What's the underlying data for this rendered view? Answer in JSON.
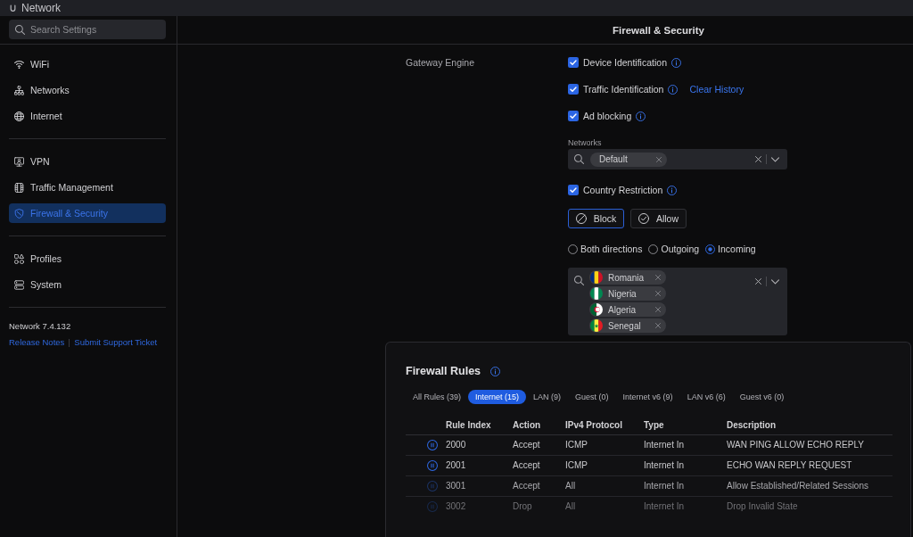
{
  "app": {
    "title": "Network"
  },
  "sidebar": {
    "search": {
      "placeholder": "Search Settings"
    },
    "sections": [
      {
        "items": [
          {
            "label": "WiFi",
            "selected": false
          },
          {
            "label": "Networks",
            "selected": false
          },
          {
            "label": "Internet",
            "selected": false
          }
        ]
      },
      {
        "items": [
          {
            "label": "VPN",
            "selected": false
          },
          {
            "label": "Traffic Management",
            "selected": false
          },
          {
            "label": "Firewall & Security",
            "selected": true
          }
        ]
      },
      {
        "items": [
          {
            "label": "Profiles",
            "selected": false
          },
          {
            "label": "System",
            "selected": false
          }
        ]
      }
    ],
    "version": "Network 7.4.132",
    "links": [
      "Release Notes",
      "Submit Support Ticket"
    ]
  },
  "page": {
    "title": "Firewall & Security"
  },
  "gateway_engine": {
    "label": "Gateway Engine",
    "options": [
      {
        "label": "Device Identification",
        "checked": true
      },
      {
        "label": "Traffic Identification",
        "checked": true,
        "link": "Clear History"
      },
      {
        "label": "Ad blocking",
        "checked": true
      }
    ],
    "networks": {
      "label": "Networks",
      "chips": [
        "Default"
      ]
    },
    "country_restriction": {
      "label": "Country Restriction",
      "checked": true
    },
    "modes": [
      {
        "label": "Block",
        "selected": true
      },
      {
        "label": "Allow",
        "selected": false
      }
    ],
    "directions": [
      {
        "label": "Both directions",
        "selected": false
      },
      {
        "label": "Outgoing",
        "selected": false
      },
      {
        "label": "Incoming",
        "selected": true
      }
    ],
    "countries": [
      "Romania",
      "Nigeria",
      "Algeria",
      "Senegal"
    ]
  },
  "firewall_rules": {
    "title": "Firewall Rules",
    "tabs": [
      {
        "label": "All Rules (39)",
        "selected": false
      },
      {
        "label": "Internet (15)",
        "selected": true
      },
      {
        "label": "LAN (9)",
        "selected": false
      },
      {
        "label": "Guest (0)",
        "selected": false
      },
      {
        "label": "Internet v6 (9)",
        "selected": false
      },
      {
        "label": "LAN v6 (6)",
        "selected": false
      },
      {
        "label": "Guest v6 (0)",
        "selected": false
      }
    ],
    "columns": [
      "Rule Index",
      "Action",
      "IPv4 Protocol",
      "Type",
      "Description"
    ],
    "rows": [
      {
        "cells": [
          "2000",
          "Accept",
          "ICMP",
          "Internet In",
          "WAN PING ALLOW ECHO REPLY"
        ]
      },
      {
        "cells": [
          "2001",
          "Accept",
          "ICMP",
          "Internet In",
          "ECHO WAN REPLY REQUEST"
        ]
      },
      {
        "cells": [
          "3001",
          "Accept",
          "All",
          "Internet In",
          "Allow Established/Related Sessions"
        ]
      },
      {
        "cells": [
          "3002",
          "Drop",
          "All",
          "Internet In",
          "Drop Invalid State"
        ]
      }
    ]
  }
}
